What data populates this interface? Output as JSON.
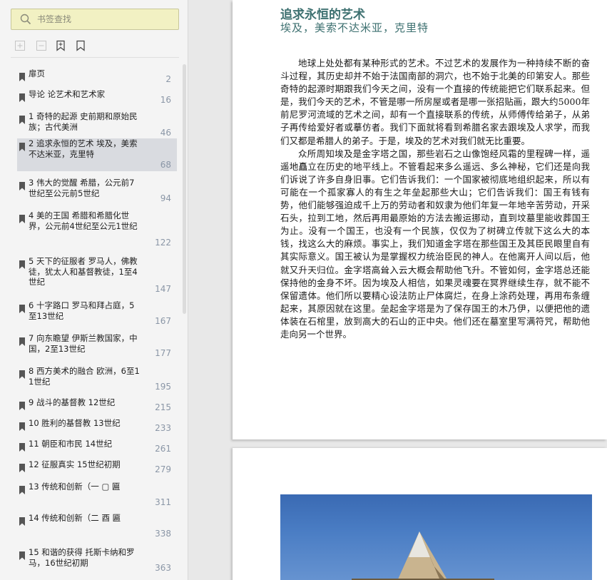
{
  "sidebar": {
    "search": {
      "placeholder": "书签查找"
    },
    "toolbar": {
      "icons": [
        "expand-all-icon",
        "collapse-all-icon",
        "add-bookmark-icon",
        "bookmark-outline-icon"
      ]
    },
    "items": [
      {
        "label": "扉页",
        "page": "2"
      },
      {
        "label": "导论 论艺术和艺术家",
        "page": "16"
      },
      {
        "label": "1 奇特的起源 史前期和原始民族；古代美洲",
        "page": "46"
      },
      {
        "label": "2 追求永恒的艺术 埃及，美索不达米亚，克里特",
        "page": "68",
        "selected": true
      },
      {
        "label": "3 伟大的觉醒 希腊，公元前7世纪至公元前5世纪",
        "page": "94"
      },
      {
        "label": "4 美的王国 希腊和希腊化世界，公元前4世纪至公元1世纪",
        "page": "122"
      },
      {
        "label": "5 天下的征服者 罗马人，佛教徒，犹太人和基督教徒，1至4世纪",
        "page": "147"
      },
      {
        "label": "6 十字路口 罗马和拜占庭，5至13世纪",
        "page": "167"
      },
      {
        "label": "7 向东瞻望 伊斯兰教国家，中国，2至13世纪",
        "page": "177"
      },
      {
        "label": "8 西方美术的融合 欧洲，6至11世纪",
        "page": "195"
      },
      {
        "label": "9 战斗的基督教 12世纪",
        "page": "215"
      },
      {
        "label": "10 胜利的基督教 13世纪",
        "page": "233"
      },
      {
        "label": "11 朝臣和市民 14世纪",
        "page": "261"
      },
      {
        "label": "12 征服真实 15世纪初期",
        "page": "279"
      },
      {
        "label": "13 传统和创新（一 ▢ 匾",
        "page": "311"
      },
      {
        "label": "14 传统和创新（二 ⾣ 匾",
        "page": "338"
      },
      {
        "label": "15 和谐的获得 托斯卡纳和罗马，16世纪初期",
        "page": "363"
      }
    ]
  },
  "document": {
    "title": "追求永恒的艺术",
    "subtitle": "埃及，美索不达米亚，克里特",
    "paragraphs": [
      "地球上处处都有某种形式的艺术。不过艺术的发展作为一种持续不断的奋斗过程，其历史却并不始于法国南部的洞穴，也不始于北美的印第安人。那些奇特的起源时期跟我们今天之间，没有一个直接的传统能把它们联系起来。但是，我们今天的艺术，不管是哪一所房屋或者是哪一张招贴画，跟大约5000年前尼罗河流域的艺术之间，却有一个直接联系的传统，从师傅传给弟子，从弟子再传给爱好者或摹仿者。我们下面就将看到希腊名家去跟埃及人求学，而我们又都是希腊人的弟子。于是，埃及的艺术对我们就无比重要。",
      "众所周知埃及是金字塔之国，那些岩石之山像饱经风霜的里程碑一样，遥遥地矗立在历史的地平线上。不管看起来多么遥远、多么神秘，它们还是向我们诉说了许多自身旧事。它们告诉我们：一个国家被彻底地组织起来，所以有可能在一个孤家寡人的有生之年垒起那些大山；它们告诉我们：国王有钱有势，他们能够强迫成千上万的劳动者和奴隶为他们年复一年地辛苦劳动，开采石头，拉到工地，然后再用最原始的方法去搬运挪动，直到坟墓里能收葬国王为止。没有一个国王，也没有一个民族，仅仅为了树碑立传就下这么大的本钱，找这么大的麻烦。事实上，我们知道金字塔在那些国王及其臣民眼里自有其实际意义。国王被认为是掌握权力统治臣民的神人。在他离开人间以后，他就又升天归位。金字塔高耸入云大概会帮助他飞升。不管如何，金字塔总还能保持他的金身不坏。因为埃及人相信，如果灵魂要在冥界继续生存，就不能不保留遗体。他们所以要精心设法防止尸体腐烂，在身上涂药处理，再用布条缠起来，其原因就在这里。垒起金字塔是为了保存国王的木乃伊，以便把他的遗体装在石棺里，放到高大的石山的正中央。他们还在墓室里写满符咒，帮助他走向另一个世界。"
    ]
  },
  "colors": {
    "accent": "#3d7070",
    "search_bg": "#f2f1c3",
    "selected_bg": "#d9dbe0",
    "page_number": "#8a96a6"
  }
}
